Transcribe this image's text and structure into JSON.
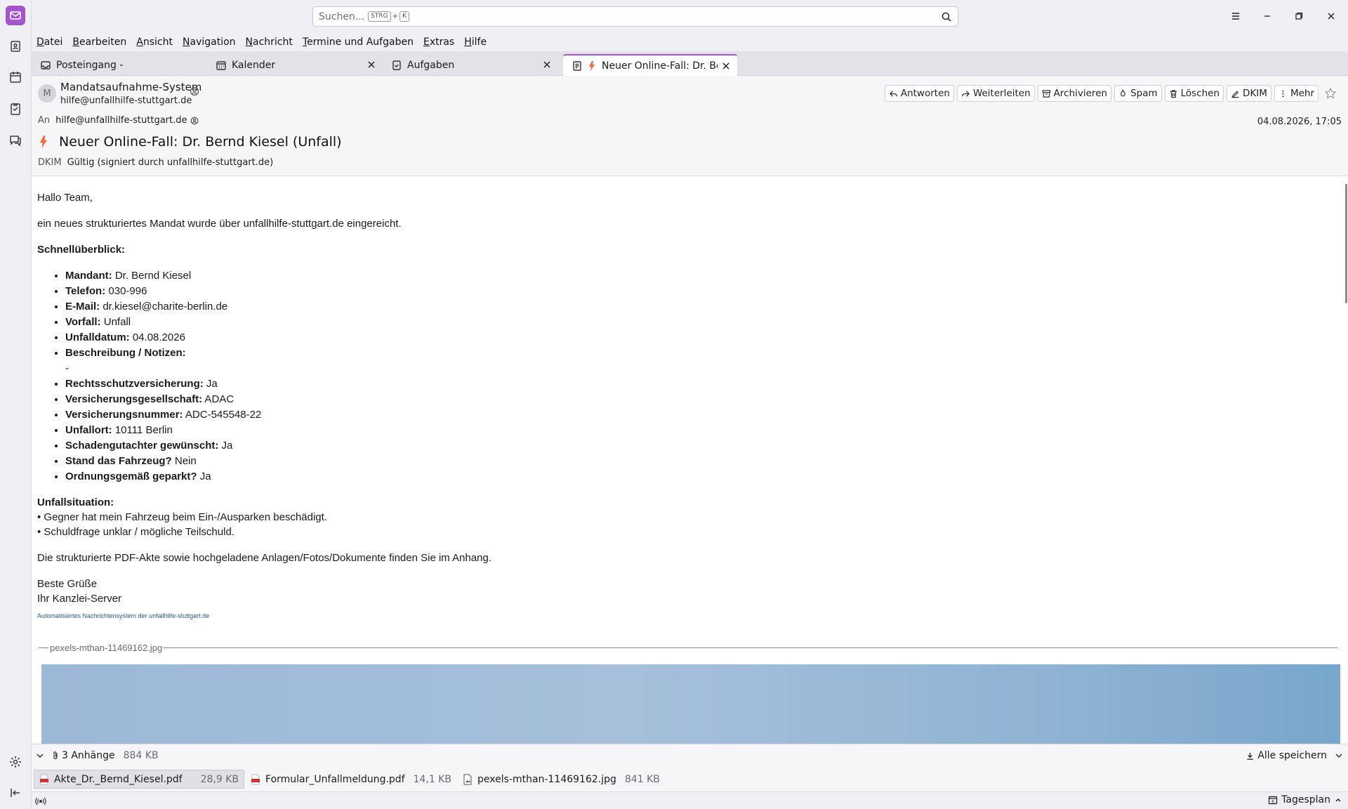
{
  "search": {
    "placeholder": "Suchen...",
    "shortcut_key1": "STRG",
    "shortcut_plus": "+",
    "shortcut_key2": "K"
  },
  "menu": [
    "Datei",
    "Bearbeiten",
    "Ansicht",
    "Navigation",
    "Nachricht",
    "Termine und Aufgaben",
    "Extras",
    "Hilfe"
  ],
  "tabs": [
    {
      "label": "Posteingang -",
      "icon": "inbox-icon"
    },
    {
      "label": "Kalender",
      "icon": "calendar-icon"
    },
    {
      "label": "Aufgaben",
      "icon": "tasks-icon"
    },
    {
      "label": "Neuer Online-Fall: Dr. Bern",
      "icon": "message-icon"
    }
  ],
  "header": {
    "avatar_letter": "M",
    "sender_name": "Mandatsaufnahme-System",
    "sender_email": "hilfe@unfallhilfe-stuttgart.de",
    "to_label": "An",
    "to_email": "hilfe@unfallhilfe-stuttgart.de",
    "date": "04.08.2026, 17:05",
    "subject": "Neuer Online-Fall: Dr. Bernd Kiesel (Unfall)",
    "dkim_label": "DKIM",
    "dkim_value": "Gültig (signiert durch unfallhilfe-stuttgart.de)"
  },
  "toolbar": {
    "reply": "Antworten",
    "forward": "Weiterleiten",
    "archive": "Archivieren",
    "spam": "Spam",
    "delete": "Löschen",
    "dkim": "DKIM",
    "more": "Mehr"
  },
  "body": {
    "greeting": "Hallo Team,",
    "intro": "ein neues strukturiertes Mandat wurde über unfallhilfe-stuttgart.de eingereicht.",
    "overview_heading": "Schnellüberblick:",
    "fields": [
      {
        "label": "Mandant:",
        "value": " Dr. Bernd Kiesel"
      },
      {
        "label": "Telefon:",
        "value": " 030-996"
      },
      {
        "label": "E-Mail:",
        "value": " dr.kiesel@charite-berlin.de"
      },
      {
        "label": "Vorfall:",
        "value": " Unfall"
      },
      {
        "label": "Unfalldatum:",
        "value": " 04.08.2026"
      },
      {
        "label": "Beschreibung / Notizen:",
        "value": ""
      },
      {
        "label": "",
        "value": "-"
      },
      {
        "label": "Rechtsschutzversicherung:",
        "value": " Ja"
      },
      {
        "label": "Versicherungsgesellschaft:",
        "value": " ADAC"
      },
      {
        "label": "Versicherungsnummer:",
        "value": " ADC-545548-22"
      },
      {
        "label": "Unfallort:",
        "value": " 10111 Berlin"
      },
      {
        "label": "Schadengutachter gewünscht:",
        "value": " Ja"
      },
      {
        "label": "Stand das Fahrzeug?",
        "value": " Nein"
      },
      {
        "label": "Ordnungsgemäß geparkt?",
        "value": " Ja"
      }
    ],
    "situation_heading": "Unfallsituation:",
    "situation_lines": [
      "• Gegner hat mein Fahrzeug beim Ein-/Ausparken beschädigt.",
      "• Schuldfrage unklar / mögliche Teilschuld."
    ],
    "closing_text": "Die strukturierte PDF-Akte sowie hochgeladene Anlagen/Fotos/Dokumente finden Sie im Anhang.",
    "sign_1": "Beste Grüße",
    "sign_2": "Ihr Kanzlei-Server",
    "footer": "Automatisiertes Nachrichtensystem der unfallhilfe-stuttgart.de",
    "inline_attachment": "pexels-mthan-11469162.jpg"
  },
  "attachments": {
    "count_label": "3 Anhänge",
    "total_size": "884 KB",
    "save_all": "Alle speichern",
    "items": [
      {
        "name": "Akte_Dr._Bernd_Kiesel.pdf",
        "size": "28,9 KB",
        "type": "pdf"
      },
      {
        "name": "Formular_Unfallmeldung.pdf",
        "size": "14,1 KB",
        "type": "pdf"
      },
      {
        "name": "pexels-mthan-11469162.jpg",
        "size": "841 KB",
        "type": "image"
      }
    ]
  },
  "statusbar": {
    "today_pane": "Tagesplan",
    "today_day": "6"
  },
  "colors": {
    "accent": "#a454cc",
    "pdf_red": "#d32f2f",
    "flame": "#f26a3d"
  }
}
